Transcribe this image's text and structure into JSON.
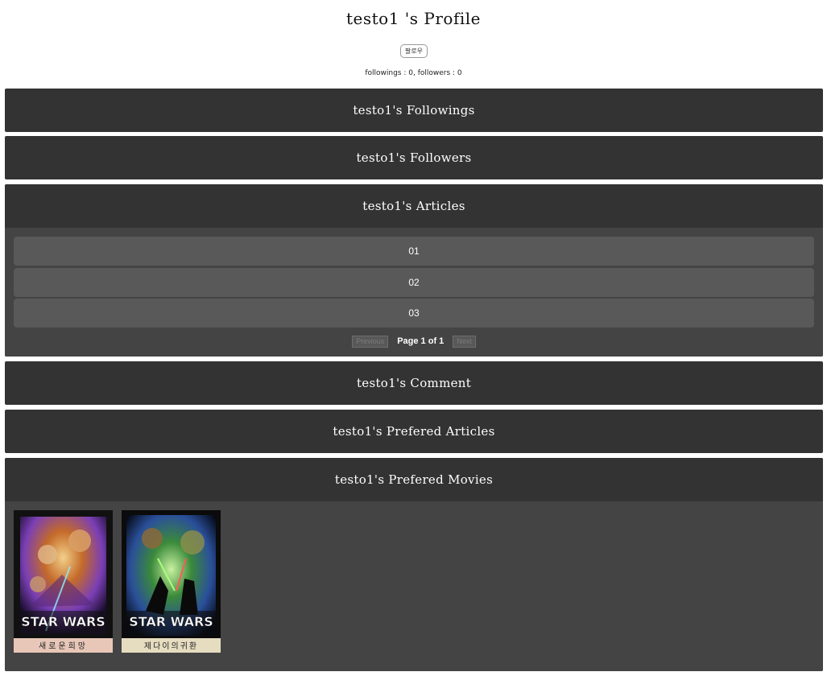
{
  "profile": {
    "title": "testo1 's Profile",
    "follow_button": "팔로우",
    "stats": "followings : 0, followers : 0"
  },
  "sections": {
    "followings": "testo1's Followings",
    "followers": "testo1's Followers",
    "articles": "testo1's Articles",
    "comment": "testo1's Comment",
    "prefered_articles": "testo1's Prefered Articles",
    "prefered_movies": "testo1's Prefered Movies"
  },
  "articles": {
    "items": [
      "01",
      "02",
      "03"
    ],
    "pagination": {
      "previous": "Previous",
      "page": "Page 1 of 1",
      "next": "Next"
    }
  },
  "movies": [
    {
      "logo": "STAR WARS",
      "subtitle": "새로운희망",
      "colors": {
        "sky": "#c46a2a",
        "accent": "#7a3fb5",
        "bg": "#111111"
      }
    },
    {
      "logo": "STAR WARS",
      "subtitle": "제다이의귀환",
      "colors": {
        "sky": "#3b8a3b",
        "accent": "#2a4f9a",
        "bg": "#0b0b0b"
      }
    }
  ],
  "colors": {
    "panel_header": "#333333",
    "panel_body": "#444444",
    "article_row": "#595959"
  }
}
